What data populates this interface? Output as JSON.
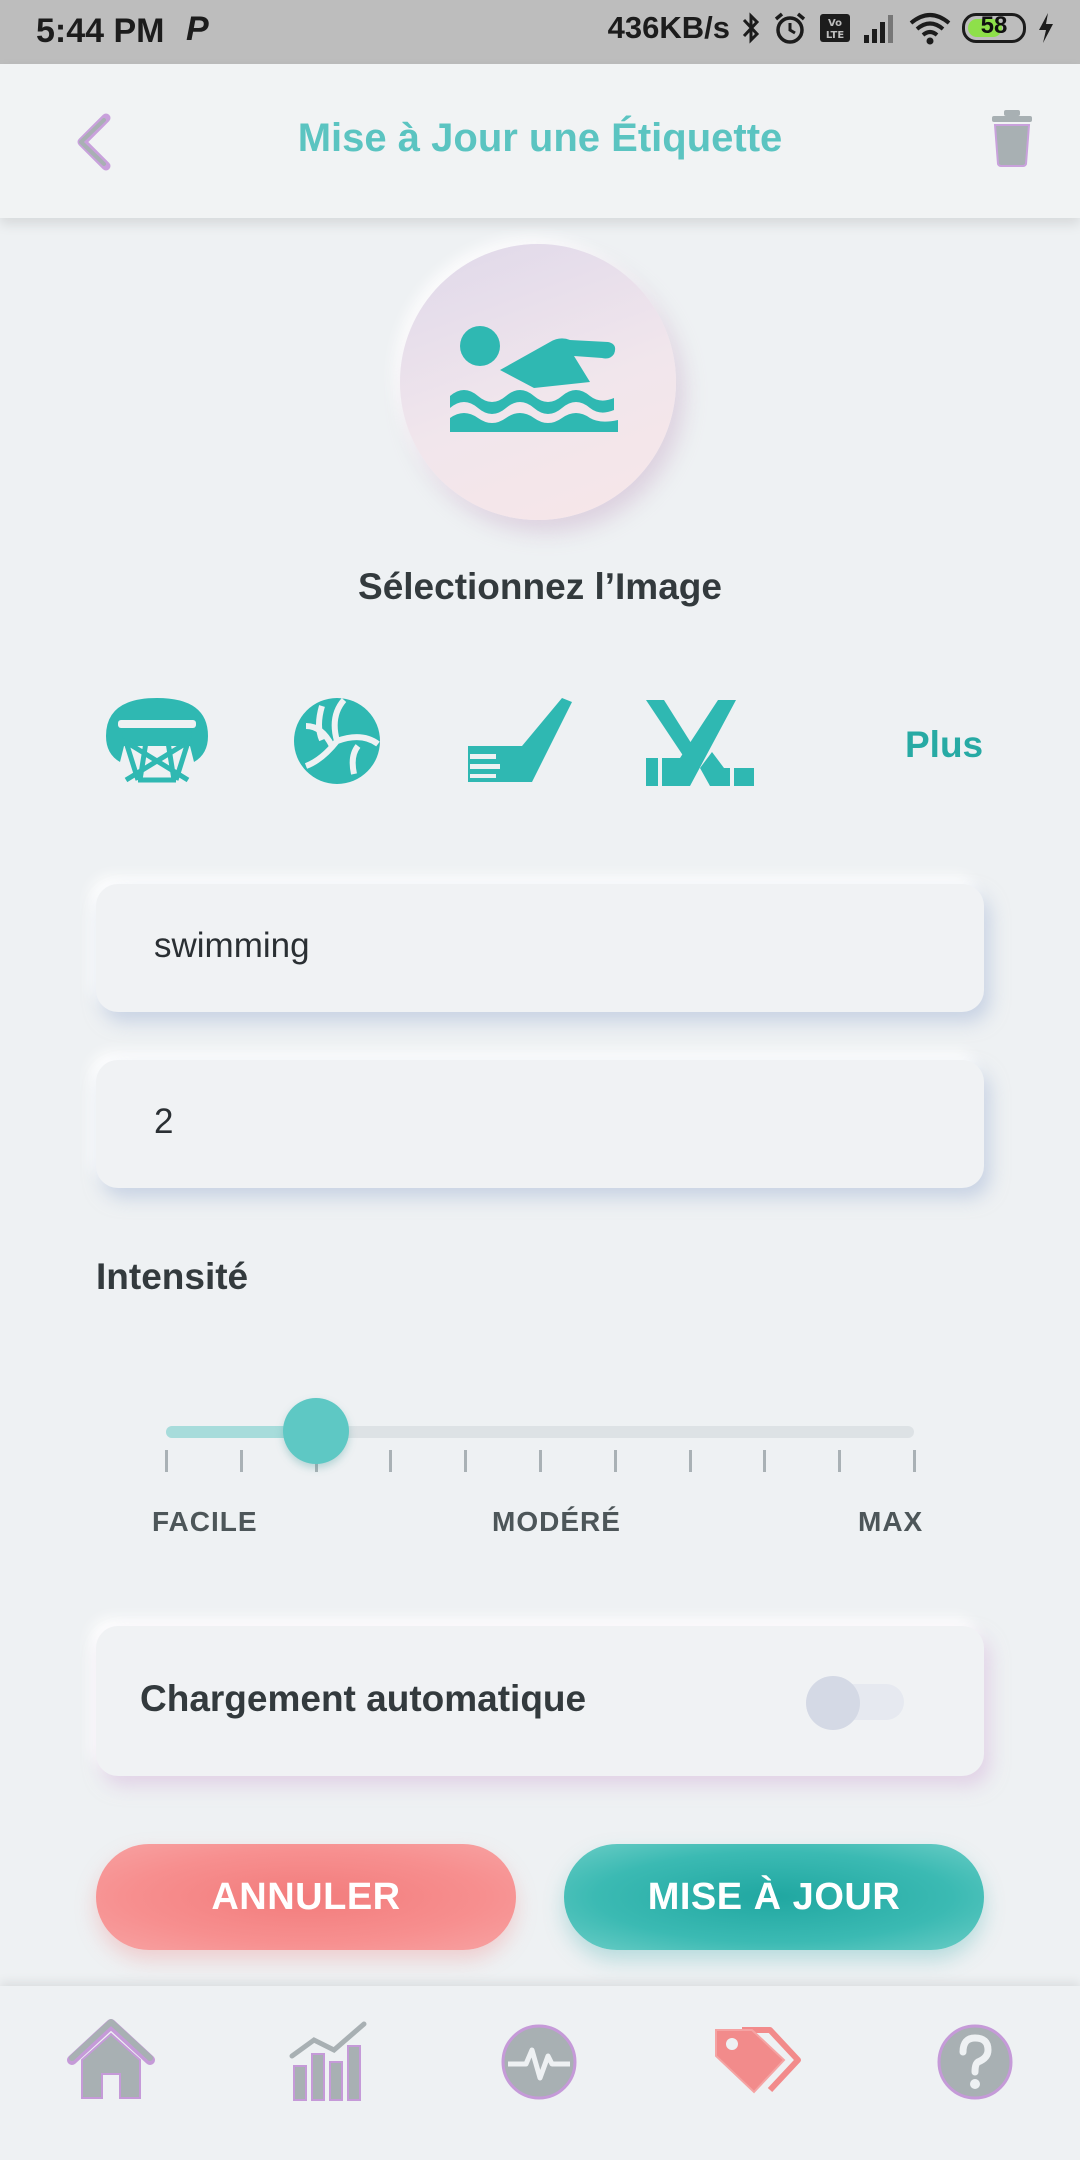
{
  "status_bar": {
    "time": "5:44 PM",
    "app_indicator": "P",
    "network_speed": "436KB/s",
    "battery_percent": "58",
    "icons": [
      "bluetooth-icon",
      "alarm-icon",
      "volte-icon",
      "signal-icon",
      "wifi-icon",
      "battery-icon",
      "charging-icon"
    ]
  },
  "header": {
    "title": "Mise à Jour une Étiquette",
    "back_icon": "chevron-left-icon",
    "delete_icon": "trash-icon"
  },
  "image_select": {
    "selected_icon": "swimming-icon",
    "label": "Sélectionnez l’Image"
  },
  "icon_options": [
    "basketball-hoop-icon",
    "volleyball-icon",
    "golf-club-icon",
    "hockey-sticks-icon"
  ],
  "more_link": "Plus",
  "fields": {
    "name_value": "swimming",
    "number_value": "2"
  },
  "intensity": {
    "label": "Intensité",
    "value_fraction": 0.2,
    "tick_count": 11,
    "labels": [
      "FACILE",
      "MODÉRÉ",
      "MAX"
    ]
  },
  "auto_load": {
    "label": "Chargement automatique",
    "enabled": false
  },
  "buttons": {
    "cancel": "ANNULER",
    "update": "MISE À JOUR"
  },
  "colors": {
    "accent": "#5bc4c1",
    "icon_teal": "#2fb8b2",
    "cancel": "#f27c7c",
    "update": "#20a7a1",
    "nav_gray": "#a8b0b3",
    "nav_active": "#f28b8b",
    "nav_outline": "#c59ad8"
  },
  "bottom_nav": {
    "items": [
      "home-icon",
      "stats-icon",
      "activity-icon",
      "tags-icon",
      "help-icon"
    ],
    "active": "tags-icon"
  }
}
